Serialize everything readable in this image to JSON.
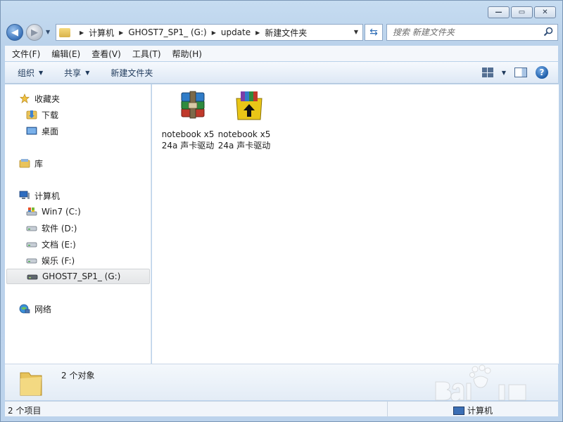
{
  "window": {
    "caption_buttons": {
      "minimize": "—",
      "maximize": "▭",
      "close": "✕"
    }
  },
  "address": {
    "crumbs": [
      "计算机",
      "GHOST7_SP1_ (G:)",
      "update",
      "新建文件夹"
    ]
  },
  "search": {
    "placeholder": "搜索 新建文件夹"
  },
  "menu": [
    "文件(F)",
    "编辑(E)",
    "查看(V)",
    "工具(T)",
    "帮助(H)"
  ],
  "toolbar": {
    "organize": "组织",
    "share": "共享",
    "new_folder": "新建文件夹"
  },
  "nav": {
    "favorites": "收藏夹",
    "downloads": "下载",
    "desktop": "桌面",
    "libraries": "库",
    "computer": "计算机",
    "drives": [
      {
        "label": "Win7 (C:)",
        "icon": "windows-drive-icon"
      },
      {
        "label": "软件 (D:)",
        "icon": "drive-icon"
      },
      {
        "label": "文档 (E:)",
        "icon": "drive-icon"
      },
      {
        "label": "娱乐 (F:)",
        "icon": "drive-icon"
      },
      {
        "label": "GHOST7_SP1_ (G:)",
        "icon": "drive-icon",
        "selected": true
      }
    ],
    "network": "网络"
  },
  "files": [
    {
      "name": "notebook x524a 声卡驱动",
      "icon": "winrar-archive-icon"
    },
    {
      "name": "notebook x524a 声卡驱动",
      "icon": "winrar-sfx-icon"
    }
  ],
  "details": {
    "count": "2 个对象"
  },
  "status": {
    "items": "2 个项目",
    "location": "计算机"
  },
  "colors": {
    "accent": "#3a72b9",
    "chrome": "#bcd3ec",
    "selection": "#e4e6e8"
  }
}
